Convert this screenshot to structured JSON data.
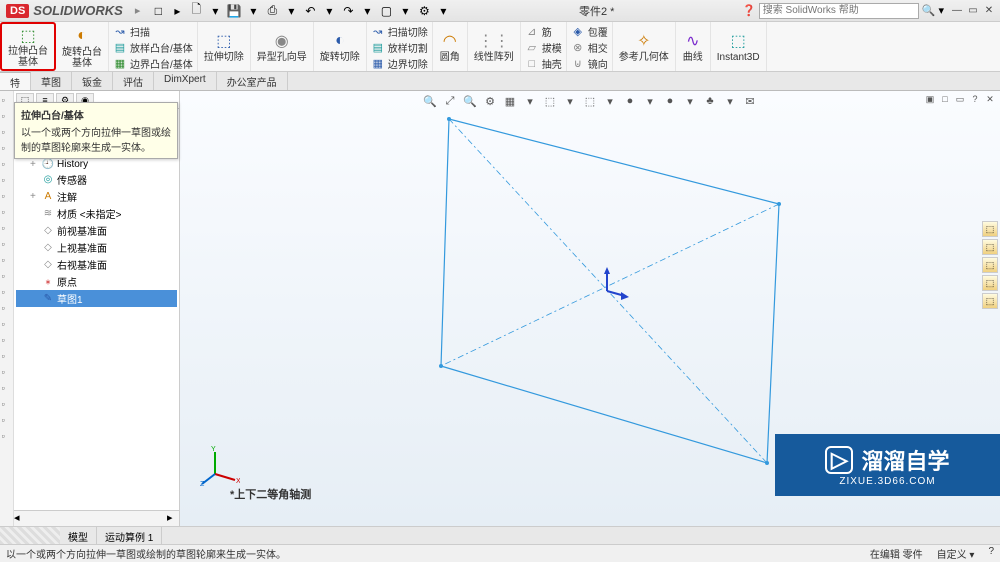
{
  "app": {
    "brand_ds": "DS",
    "brand": "SOLIDWORKS",
    "doc_title": "零件2 *",
    "search_placeholder": "搜索 SolidWorks 帮助"
  },
  "qat": [
    "□",
    "▸",
    "🗋",
    "▾",
    "💾",
    "▾",
    "⎙",
    "▾",
    "↶",
    "▾",
    "↷",
    "▾",
    "▢",
    "▾",
    "⚙",
    "▾"
  ],
  "ribbon": {
    "big": [
      {
        "key": "extrude",
        "label": "拉伸凸台/基体",
        "icon": "⬚",
        "cls": "c-green",
        "highlight": true
      },
      {
        "key": "revolve",
        "label": "旋转凸台/基体",
        "icon": "◐",
        "cls": "c-orange"
      }
    ],
    "grp1": [
      {
        "label": "扫描",
        "icon": "↝",
        "cls": "c-blue"
      },
      {
        "label": "放样凸台/基体",
        "icon": "▤",
        "cls": "c-teal"
      },
      {
        "label": "边界凸台/基体",
        "icon": "▦",
        "cls": "c-green"
      }
    ],
    "big2": [
      {
        "key": "cut_ext",
        "label": "拉伸切除",
        "icon": "⬚",
        "cls": "c-blue"
      },
      {
        "key": "hole",
        "label": "异型孔向导",
        "icon": "◉",
        "cls": "c-gray"
      },
      {
        "key": "cut_rev",
        "label": "旋转切除",
        "icon": "◐",
        "cls": "c-blue"
      }
    ],
    "grp2": [
      {
        "label": "扫描切除",
        "icon": "↝",
        "cls": "c-blue"
      },
      {
        "label": "放样切割",
        "icon": "▤",
        "cls": "c-teal"
      },
      {
        "label": "边界切除",
        "icon": "▦",
        "cls": "c-blue"
      }
    ],
    "big3": [
      {
        "key": "fillet",
        "label": "圆角",
        "icon": "◠",
        "cls": "c-orange"
      },
      {
        "key": "pattern",
        "label": "线性阵列",
        "icon": "⋮⋮",
        "cls": "c-gray"
      }
    ],
    "grp3": [
      {
        "label": "筋",
        "icon": "⊿",
        "cls": "c-gray"
      },
      {
        "label": "拔模",
        "icon": "▱",
        "cls": "c-gray"
      },
      {
        "label": "抽壳",
        "icon": "□",
        "cls": "c-gray"
      }
    ],
    "grp4": [
      {
        "label": "包覆",
        "icon": "◈",
        "cls": "c-blue"
      },
      {
        "label": "相交",
        "icon": "⊗",
        "cls": "c-gray"
      },
      {
        "label": "镜向",
        "icon": "⊍",
        "cls": "c-gray"
      }
    ],
    "big4": [
      {
        "key": "refgeom",
        "label": "参考几何体",
        "icon": "✧",
        "cls": "c-orange"
      },
      {
        "key": "curves",
        "label": "曲线",
        "icon": "∿",
        "cls": "c-purple"
      },
      {
        "key": "instant3d",
        "label": "Instant3D",
        "icon": "⬚",
        "cls": "c-teal"
      }
    ]
  },
  "tabs": [
    "特",
    "草图",
    "钣金",
    "评估",
    "DimXpert",
    "办公室产品"
  ],
  "tooltip": {
    "title": "拉伸凸台/基体",
    "desc": "以一个或两个方向拉伸一草图或绘制的草图轮廓来生成一实体。"
  },
  "tree": [
    {
      "icon": "🕘",
      "label": "History",
      "indent": 1,
      "cls": "c-blue",
      "exp": "+"
    },
    {
      "icon": "◎",
      "label": "传感器",
      "indent": 1,
      "cls": "c-teal"
    },
    {
      "icon": "A",
      "label": "注解",
      "indent": 1,
      "cls": "c-orange",
      "exp": "+"
    },
    {
      "icon": "≋",
      "label": "材质 <未指定>",
      "indent": 1,
      "cls": "c-gray"
    },
    {
      "icon": "◇",
      "label": "前视基准面",
      "indent": 1,
      "cls": "c-gray"
    },
    {
      "icon": "◇",
      "label": "上视基准面",
      "indent": 1,
      "cls": "c-gray"
    },
    {
      "icon": "◇",
      "label": "右视基准面",
      "indent": 1,
      "cls": "c-gray"
    },
    {
      "icon": "⁎",
      "label": "原点",
      "indent": 1,
      "cls": "c-red"
    },
    {
      "icon": "✎",
      "label": "草图1",
      "indent": 1,
      "cls": "c-blue",
      "sel": true
    }
  ],
  "viewtb": [
    "🔍",
    "⤢",
    "🔍",
    "⚙",
    "▦",
    "▾",
    "⬚",
    "▾",
    "⬚",
    "▾",
    "●",
    "▾",
    "●",
    "▾",
    "♣",
    "▾",
    "✉"
  ],
  "viewctrl": [
    "▣",
    "□",
    "▭",
    "?",
    "✕"
  ],
  "righttb": [
    "⬚",
    "⬚",
    "⬚",
    "⬚",
    "⬚"
  ],
  "viewlabel": "*上下二等角轴测",
  "bottomtabs": {
    "model": "模型",
    "motion": "运动算例 1"
  },
  "status": {
    "left": "以一个或两个方向拉伸一草图或绘制的草图轮廓来生成一实体。",
    "mid": "在编辑 零件",
    "custom": "自定义  ▾",
    "q": "?"
  },
  "watermark": {
    "main": "溜溜自学",
    "sub": "ZIXUE.3D66.COM"
  }
}
